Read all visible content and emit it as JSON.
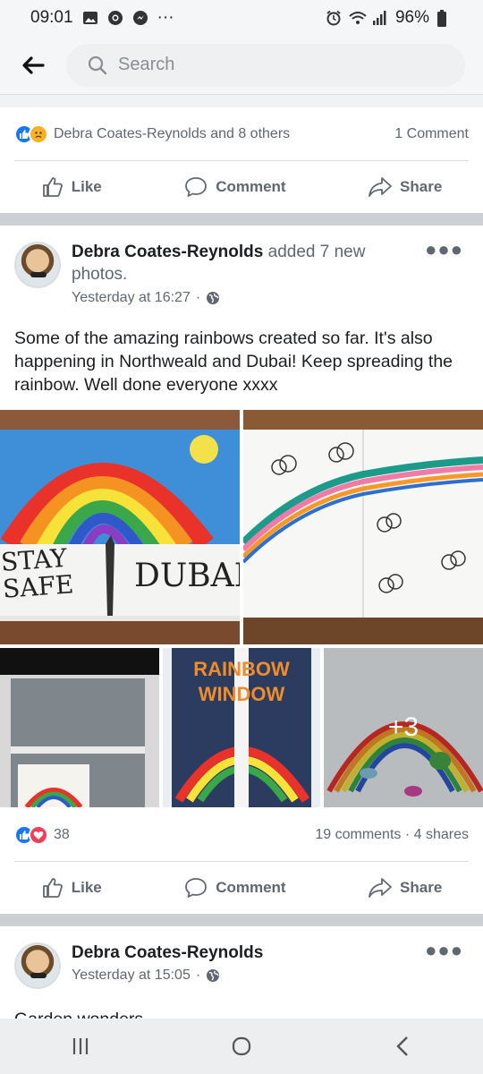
{
  "status_bar": {
    "time": "09:01",
    "dots": "···",
    "battery": "96%"
  },
  "search": {
    "placeholder": "Search"
  },
  "prev_post": {
    "reactions_text": "Debra Coates-Reynolds and 8 others",
    "comments_count": "1 Comment",
    "actions": {
      "like": "Like",
      "comment": "Comment",
      "share": "Share"
    }
  },
  "post": {
    "author": "Debra Coates-Reynolds",
    "action_text": " added 7 new photos.",
    "time": "Yesterday at 16:27",
    "time_sep": "·",
    "text": "Some of the amazing rainbows created so far. It's also happening in Northweald and Dubai! Keep spreading the rainbow. Well done everyone xxxx",
    "photo1_text_left": "STAY SAFE",
    "photo1_text_right": "DUBAI",
    "photo4_title_1": "RAINBOW",
    "photo4_title_2": "WINDOW",
    "more_photos": "+3",
    "reaction_count": "38",
    "comments": "19 comments",
    "stat_sep": "·",
    "shares": "4 shares",
    "actions": {
      "like": "Like",
      "comment": "Comment",
      "share": "Share"
    }
  },
  "next_post": {
    "author": "Debra Coates-Reynolds",
    "time": "Yesterday at 15:05",
    "time_sep": "·",
    "text_partial": "Garden wonders"
  },
  "colors": {
    "accent": "#1877f2",
    "love": "#f33e58",
    "haha": "#f7b125"
  }
}
